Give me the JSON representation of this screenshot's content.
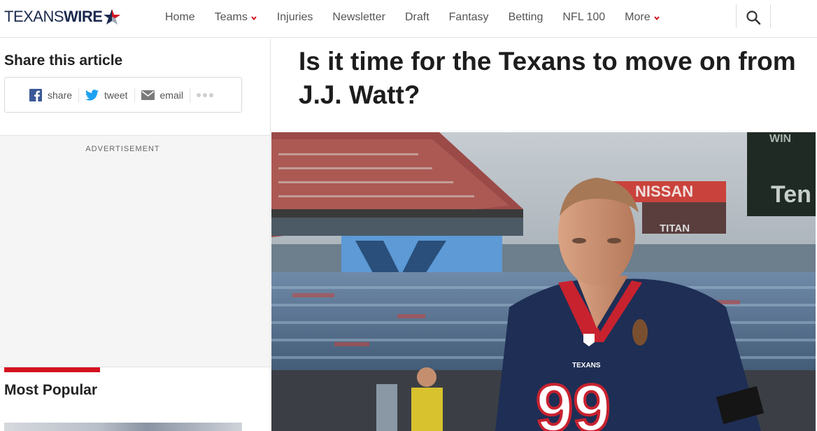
{
  "site": {
    "logo_part1": "TEXANS",
    "logo_part2": "WIRE"
  },
  "nav": {
    "items": [
      {
        "label": "Home",
        "dropdown": false
      },
      {
        "label": "Teams",
        "dropdown": true
      },
      {
        "label": "Injuries",
        "dropdown": false
      },
      {
        "label": "Newsletter",
        "dropdown": false
      },
      {
        "label": "Draft",
        "dropdown": false
      },
      {
        "label": "Fantasy",
        "dropdown": false
      },
      {
        "label": "Betting",
        "dropdown": false
      },
      {
        "label": "NFL 100",
        "dropdown": false
      },
      {
        "label": "More",
        "dropdown": true
      }
    ],
    "search_icon": "search-icon"
  },
  "sidebar": {
    "share_title": "Share this article",
    "share_buttons": [
      {
        "label": "share",
        "icon": "facebook-icon"
      },
      {
        "label": "tweet",
        "icon": "twitter-icon"
      },
      {
        "label": "email",
        "icon": "email-icon"
      }
    ],
    "ad_label": "ADVERTISEMENT",
    "popular_title": "Most Popular"
  },
  "article": {
    "headline": "Is it time for the Texans to move on from J.J. Watt?"
  },
  "hero": {
    "jersey_number": "99",
    "jersey_team": "TEXANS",
    "stadium_sign": "NISSAN",
    "stadium_sign_2": "TITAN",
    "board_text": "Ten",
    "board_top": "WIN"
  },
  "colors": {
    "brand_navy": "#1b2a4e",
    "accent_red": "#d3131f",
    "facebook": "#3b5998",
    "twitter": "#1da1f2"
  }
}
